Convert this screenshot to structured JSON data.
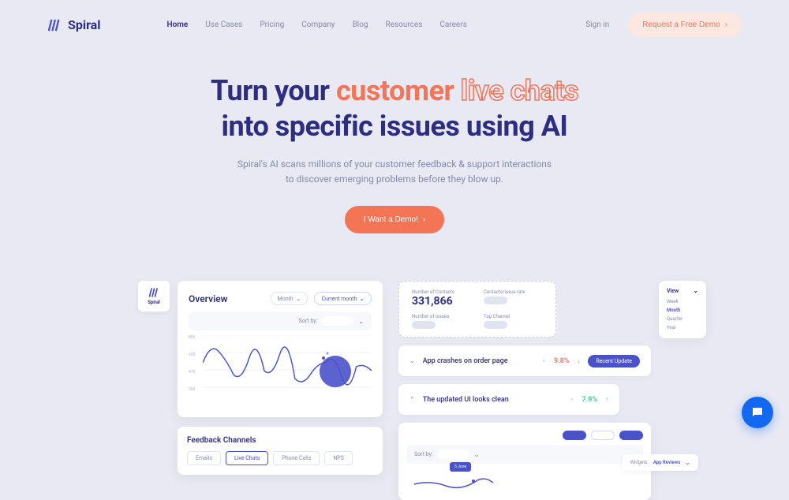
{
  "brand": "Spiral",
  "nav": {
    "items": [
      "Home",
      "Use Cases",
      "Pricing",
      "Company",
      "Blog",
      "Resources",
      "Careers"
    ],
    "signin": "Sign in",
    "cta": "Request a Free Demo"
  },
  "hero": {
    "title_1": "Turn your ",
    "title_highlight1": "customer",
    "title_highlight2": "live chats",
    "title_2": "into specific issues using AI",
    "subtitle_1": "Spiral's AI scans millions of your customer feedback & support interactions",
    "subtitle_2": "to discover emerging problems before they blow up.",
    "cta": "I Want a Demo!"
  },
  "dashboard": {
    "overview": {
      "title": "Overview",
      "period": "Month",
      "range": "Current month",
      "sort": "Sort by:",
      "yaxis": [
        "800",
        "650",
        "470",
        "280"
      ]
    },
    "channels": {
      "title": "Feedback Channels",
      "tabs": [
        "Emails",
        "Live Chats",
        "Phone Calls",
        "NPS"
      ]
    },
    "stats": {
      "contacts_label": "Number of Contacts",
      "contacts_value": "331,866",
      "rate_label": "Contacts/issue rate",
      "issues_label": "Number of Issues",
      "channel_label": "Top Channel"
    },
    "view": {
      "title": "View",
      "items": [
        "Week",
        "Month",
        "Quarter",
        "Year"
      ]
    },
    "issues": [
      {
        "text": "App crashes on order page",
        "percent": "9.8%",
        "button": "Recent Update"
      },
      {
        "text": "The updated UI looks clean",
        "percent": "7.9%"
      }
    ],
    "widgets": {
      "label": "Widgets:",
      "value": "App Reviews"
    },
    "tooltip": "3 June"
  }
}
